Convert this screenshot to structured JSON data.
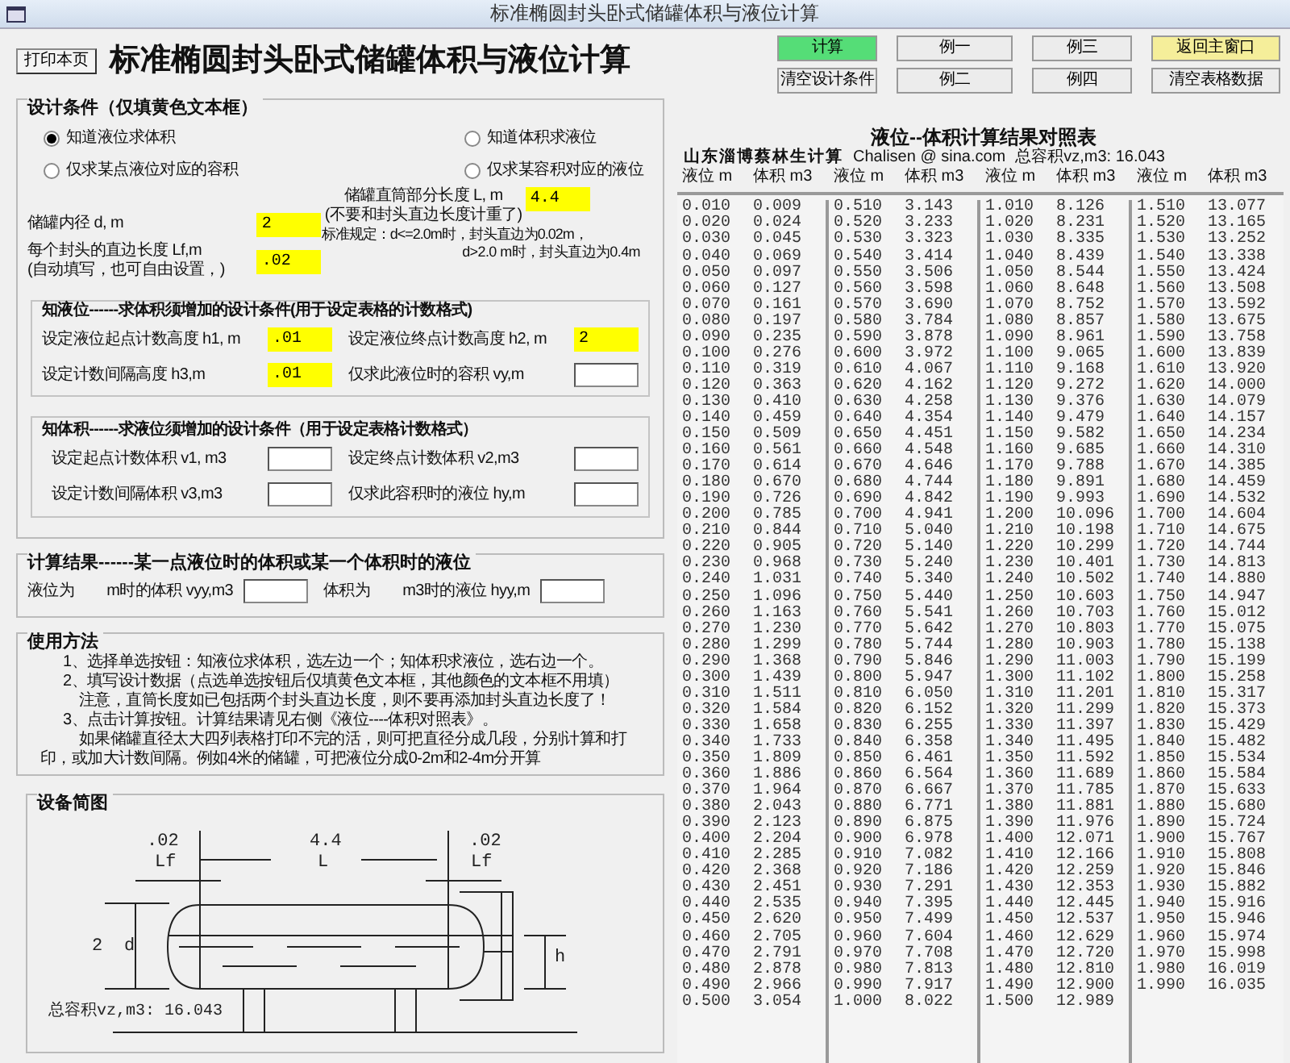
{
  "window": {
    "title": "标准椭圆封头卧式储罐体积与液位计算"
  },
  "print_button": "打印本页",
  "heading": "标准椭圆封头卧式储罐体积与液位计算",
  "toolbar": [
    [
      {
        "label": "计算",
        "color": "#55dd77"
      },
      {
        "label": "例一",
        "color": "#ececec"
      },
      {
        "label": "例三",
        "color": "#ececec"
      },
      {
        "label": "返回主窗口",
        "color": "#f5ee9a"
      }
    ],
    [
      {
        "label": "清空设计条件",
        "color": "#ececec"
      },
      {
        "label": "例二",
        "color": "#ececec"
      },
      {
        "label": "例四",
        "color": "#ececec"
      },
      {
        "label": "清空表格数据",
        "color": "#ececec"
      }
    ]
  ],
  "design": {
    "title": "设计条件（仅填黄色文本框）",
    "radios": [
      {
        "label": "知道液位求体积",
        "selected": true
      },
      {
        "label": "知道体积求液位",
        "selected": false
      },
      {
        "label": "仅求某点液位对应的容积",
        "selected": false
      },
      {
        "label": "仅求某容积对应的液位",
        "selected": false
      }
    ],
    "fields": [
      {
        "label": "储罐内径 d, m",
        "value": "2",
        "highlighted": true
      },
      {
        "label": "储罐直筒部分长度 L, m",
        "note": "(不要和封头直边长度计重了)",
        "value": "4.4",
        "highlighted": true
      },
      {
        "label": "每个封头的直边长度 Lf,m",
        "note": "(自动填写，也可自由设置，)",
        "value": ".02",
        "highlighted": true
      }
    ],
    "rule": [
      "标准规定：d<=2.0m时，封头直边为0.02m，",
      "d>2.0 m时，封头直边为0.4m"
    ]
  },
  "level_section": {
    "title": "知液位------求体积须增加的设计条件(用于设定表格的计数格式)",
    "fields": [
      {
        "label": "设定液位起点计数高度 h1, m",
        "value": ".01",
        "highlighted": true
      },
      {
        "label": "设定液位终点计数高度 h2, m",
        "value": "2",
        "highlighted": true
      },
      {
        "label": "设定计数间隔高度 h3,m",
        "value": ".01",
        "highlighted": true
      },
      {
        "label": "仅求此液位时的容积 vy,m",
        "highlighted": false
      }
    ]
  },
  "volume_section": {
    "title": "知体积------求液位须增加的设计条件（用于设定表格计数格式）",
    "fields": [
      {
        "label": "设定起点计数体积 v1, m3",
        "highlighted": false
      },
      {
        "label": "设定终点计数体积 v2,m3",
        "highlighted": false
      },
      {
        "label": "设定计数间隔体积 v3,m3",
        "highlighted": false
      },
      {
        "label": "仅求此容积时的液位 hy,m",
        "highlighted": false
      }
    ]
  },
  "result": {
    "title": "计算结果------某一点液位时的体积或某一个体积时的液位",
    "fields": [
      {
        "prefix": "液位为",
        "label": "m时的体积 vyy,m3",
        "highlighted": false
      },
      {
        "prefix": "体积为",
        "label": "m3时的液位 hyy,m",
        "highlighted": false
      }
    ]
  },
  "usage": {
    "title": "使用方法",
    "lines": [
      {
        "kind": "step",
        "text": "1、选择单选按钮：知液位求体积，选左边一个；知体积求液位，选右边一个。"
      },
      {
        "kind": "step",
        "text": "2、填写设计数据（点选单选按钮后仅填黄色文本框，其他颜色的文本框不用填）"
      },
      {
        "kind": "note",
        "text": "注意，直筒长度如已包括两个封头直边长度，则不要再添加封头直边长度了！"
      },
      {
        "kind": "step",
        "text": "3、点击计算按钮。计算结果请见右侧《液位----体积对照表》。"
      },
      {
        "kind": "para",
        "text": "如果储罐直径太大四列表格打印不完的活，则可把直径分成几段，分别计算和打印，或加大计数间隔。例如4米的储罐，可把液位分成0-2m和2-4m分开算"
      }
    ]
  },
  "diagram": {
    "title": "设备简图",
    "lf_left": ".02",
    "length": "4.4",
    "lf_right": ".02",
    "lf_left_symbol": "Lf",
    "length_symbol": "L",
    "lf_right_symbol": "Lf",
    "diameter": "2",
    "diameter_symbol": "d",
    "level_symbol": "h",
    "total": "总容积vz,m3: 16.043"
  },
  "table": {
    "title": "液位--体积计算结果对照表",
    "author": "山东淄博蔡林生计算",
    "email": "Chalisen @ sina.com",
    "total": "总容积vz,m3: 16.043",
    "columns": [
      "液位 m",
      "体积 m3",
      "液位 m",
      "体积 m3",
      "液位 m",
      "体积 m3",
      "液位 m",
      "体积 m3"
    ],
    "rows": [
      [
        "0.010",
        "0.009",
        "0.510",
        "3.143",
        "1.010",
        "8.126",
        "1.510",
        "13.077"
      ],
      [
        "0.020",
        "0.024",
        "0.520",
        "3.233",
        "1.020",
        "8.231",
        "1.520",
        "13.165"
      ],
      [
        "0.030",
        "0.045",
        "0.530",
        "3.323",
        "1.030",
        "8.335",
        "1.530",
        "13.252"
      ],
      [
        "0.040",
        "0.069",
        "0.540",
        "3.414",
        "1.040",
        "8.439",
        "1.540",
        "13.338"
      ],
      [
        "0.050",
        "0.097",
        "0.550",
        "3.506",
        "1.050",
        "8.544",
        "1.550",
        "13.424"
      ],
      [
        "0.060",
        "0.127",
        "0.560",
        "3.598",
        "1.060",
        "8.648",
        "1.560",
        "13.508"
      ],
      [
        "0.070",
        "0.161",
        "0.570",
        "3.690",
        "1.070",
        "8.752",
        "1.570",
        "13.592"
      ],
      [
        "0.080",
        "0.197",
        "0.580",
        "3.784",
        "1.080",
        "8.857",
        "1.580",
        "13.675"
      ],
      [
        "0.090",
        "0.235",
        "0.590",
        "3.878",
        "1.090",
        "8.961",
        "1.590",
        "13.758"
      ],
      [
        "0.100",
        "0.276",
        "0.600",
        "3.972",
        "1.100",
        "9.065",
        "1.600",
        "13.839"
      ],
      [
        "0.110",
        "0.319",
        "0.610",
        "4.067",
        "1.110",
        "9.168",
        "1.610",
        "13.920"
      ],
      [
        "0.120",
        "0.363",
        "0.620",
        "4.162",
        "1.120",
        "9.272",
        "1.620",
        "14.000"
      ],
      [
        "0.130",
        "0.410",
        "0.630",
        "4.258",
        "1.130",
        "9.376",
        "1.630",
        "14.079"
      ],
      [
        "0.140",
        "0.459",
        "0.640",
        "4.354",
        "1.140",
        "9.479",
        "1.640",
        "14.157"
      ],
      [
        "0.150",
        "0.509",
        "0.650",
        "4.451",
        "1.150",
        "9.582",
        "1.650",
        "14.234"
      ],
      [
        "0.160",
        "0.561",
        "0.660",
        "4.548",
        "1.160",
        "9.685",
        "1.660",
        "14.310"
      ],
      [
        "0.170",
        "0.614",
        "0.670",
        "4.646",
        "1.170",
        "9.788",
        "1.670",
        "14.385"
      ],
      [
        "0.180",
        "0.670",
        "0.680",
        "4.744",
        "1.180",
        "9.891",
        "1.680",
        "14.459"
      ],
      [
        "0.190",
        "0.726",
        "0.690",
        "4.842",
        "1.190",
        "9.993",
        "1.690",
        "14.532"
      ],
      [
        "0.200",
        "0.785",
        "0.700",
        "4.941",
        "1.200",
        "10.096",
        "1.700",
        "14.604"
      ],
      [
        "0.210",
        "0.844",
        "0.710",
        "5.040",
        "1.210",
        "10.198",
        "1.710",
        "14.675"
      ],
      [
        "0.220",
        "0.905",
        "0.720",
        "5.140",
        "1.220",
        "10.299",
        "1.720",
        "14.744"
      ],
      [
        "0.230",
        "0.968",
        "0.730",
        "5.240",
        "1.230",
        "10.401",
        "1.730",
        "14.813"
      ],
      [
        "0.240",
        "1.031",
        "0.740",
        "5.340",
        "1.240",
        "10.502",
        "1.740",
        "14.880"
      ],
      [
        "0.250",
        "1.096",
        "0.750",
        "5.440",
        "1.250",
        "10.603",
        "1.750",
        "14.947"
      ],
      [
        "0.260",
        "1.163",
        "0.760",
        "5.541",
        "1.260",
        "10.703",
        "1.760",
        "15.012"
      ],
      [
        "0.270",
        "1.230",
        "0.770",
        "5.642",
        "1.270",
        "10.803",
        "1.770",
        "15.075"
      ],
      [
        "0.280",
        "1.299",
        "0.780",
        "5.744",
        "1.280",
        "10.903",
        "1.780",
        "15.138"
      ],
      [
        "0.290",
        "1.368",
        "0.790",
        "5.846",
        "1.290",
        "11.003",
        "1.790",
        "15.199"
      ],
      [
        "0.300",
        "1.439",
        "0.800",
        "5.947",
        "1.300",
        "11.102",
        "1.800",
        "15.258"
      ],
      [
        "0.310",
        "1.511",
        "0.810",
        "6.050",
        "1.310",
        "11.201",
        "1.810",
        "15.317"
      ],
      [
        "0.320",
        "1.584",
        "0.820",
        "6.152",
        "1.320",
        "11.299",
        "1.820",
        "15.373"
      ],
      [
        "0.330",
        "1.658",
        "0.830",
        "6.255",
        "1.330",
        "11.397",
        "1.830",
        "15.429"
      ],
      [
        "0.340",
        "1.733",
        "0.840",
        "6.358",
        "1.340",
        "11.495",
        "1.840",
        "15.482"
      ],
      [
        "0.350",
        "1.809",
        "0.850",
        "6.461",
        "1.350",
        "11.592",
        "1.850",
        "15.534"
      ],
      [
        "0.360",
        "1.886",
        "0.860",
        "6.564",
        "1.360",
        "11.689",
        "1.860",
        "15.584"
      ],
      [
        "0.370",
        "1.964",
        "0.870",
        "6.667",
        "1.370",
        "11.785",
        "1.870",
        "15.633"
      ],
      [
        "0.380",
        "2.043",
        "0.880",
        "6.771",
        "1.380",
        "11.881",
        "1.880",
        "15.680"
      ],
      [
        "0.390",
        "2.123",
        "0.890",
        "6.875",
        "1.390",
        "11.976",
        "1.890",
        "15.724"
      ],
      [
        "0.400",
        "2.204",
        "0.900",
        "6.978",
        "1.400",
        "12.071",
        "1.900",
        "15.767"
      ],
      [
        "0.410",
        "2.285",
        "0.910",
        "7.082",
        "1.410",
        "12.166",
        "1.910",
        "15.808"
      ],
      [
        "0.420",
        "2.368",
        "0.920",
        "7.186",
        "1.420",
        "12.259",
        "1.920",
        "15.846"
      ],
      [
        "0.430",
        "2.451",
        "0.930",
        "7.291",
        "1.430",
        "12.353",
        "1.930",
        "15.882"
      ],
      [
        "0.440",
        "2.535",
        "0.940",
        "7.395",
        "1.440",
        "12.445",
        "1.940",
        "15.916"
      ],
      [
        "0.450",
        "2.620",
        "0.950",
        "7.499",
        "1.450",
        "12.537",
        "1.950",
        "15.946"
      ],
      [
        "0.460",
        "2.705",
        "0.960",
        "7.604",
        "1.460",
        "12.629",
        "1.960",
        "15.974"
      ],
      [
        "0.470",
        "2.791",
        "0.970",
        "7.708",
        "1.470",
        "12.720",
        "1.970",
        "15.998"
      ],
      [
        "0.480",
        "2.878",
        "0.980",
        "7.813",
        "1.480",
        "12.810",
        "1.980",
        "16.019"
      ],
      [
        "0.490",
        "2.966",
        "0.990",
        "7.917",
        "1.490",
        "12.900",
        "1.990",
        "16.035"
      ],
      [
        "0.500",
        "3.054",
        "1.000",
        "8.022",
        "1.500",
        "12.989"
      ]
    ]
  }
}
